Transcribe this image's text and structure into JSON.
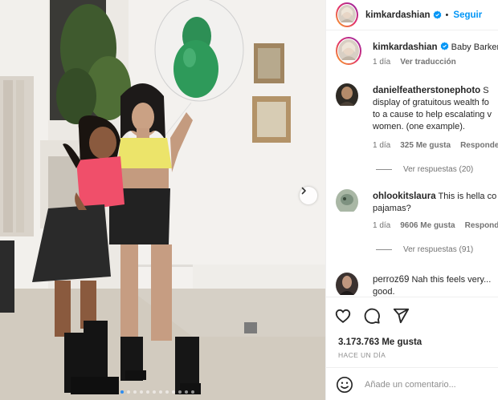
{
  "post": {
    "username": "kimkardashian",
    "follow_label": "Seguir",
    "separator": "•",
    "likes": "3.173.763 Me gusta",
    "time_ago": "HACE UN DÍA",
    "add_comment_placeholder": "Añade un comentario..."
  },
  "caption": {
    "username": "kimkardashian",
    "text": "Baby Barker",
    "time": "1 día",
    "translate_label": "Ver traducción"
  },
  "comments": [
    {
      "username": "danielfeatherstonephoto",
      "lines": [
        "S",
        "display of gratuitous wealth fo",
        "to a cause to help escalating v",
        "women. (one example)."
      ],
      "time": "1 día",
      "likes": "325 Me gusta",
      "reply_label": "Responder",
      "view_replies": "Ver respuestas (20)"
    },
    {
      "username": "ohlookitslaura",
      "lines": [
        "This is hella co",
        "pajamas?"
      ],
      "time": "1 día",
      "likes": "9606 Me gusta",
      "reply_label": "Responde",
      "view_replies": "Ver respuestas (91)"
    },
    {
      "username": "perroz69",
      "lines": [
        "Nah this feels very...",
        "good."
      ]
    }
  ],
  "icons": {
    "like": "heart-icon",
    "comment": "speech-bubble-icon",
    "share": "paper-plane-icon",
    "emoji": "smiley-icon",
    "verified": "verified-badge-icon",
    "next": "chevron-right-icon"
  },
  "colors": {
    "link_blue": "#0095f6",
    "verified_blue": "#0095f6",
    "active_dot": "#2d8cf0",
    "meta_gray": "#737373"
  },
  "carousel": {
    "total": 12,
    "active_index": 0
  }
}
